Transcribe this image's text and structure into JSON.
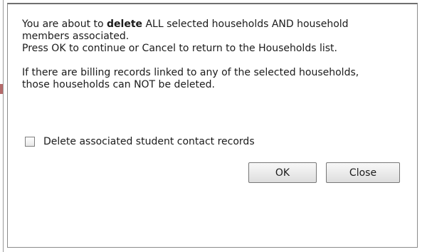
{
  "dialog": {
    "message": {
      "line1_prefix": "You are about to ",
      "line1_bold": "delete",
      "line1_suffix": " ALL selected households AND household",
      "line2": "members associated.",
      "line3": "Press OK to continue or Cancel to return to the Households list.",
      "line4": "If there are billing records linked to any of the selected households,",
      "line5": "those households can NOT be deleted."
    },
    "checkbox": {
      "label": "Delete associated student contact records",
      "checked": false
    },
    "buttons": {
      "ok_label": "OK",
      "close_label": "Close"
    }
  }
}
